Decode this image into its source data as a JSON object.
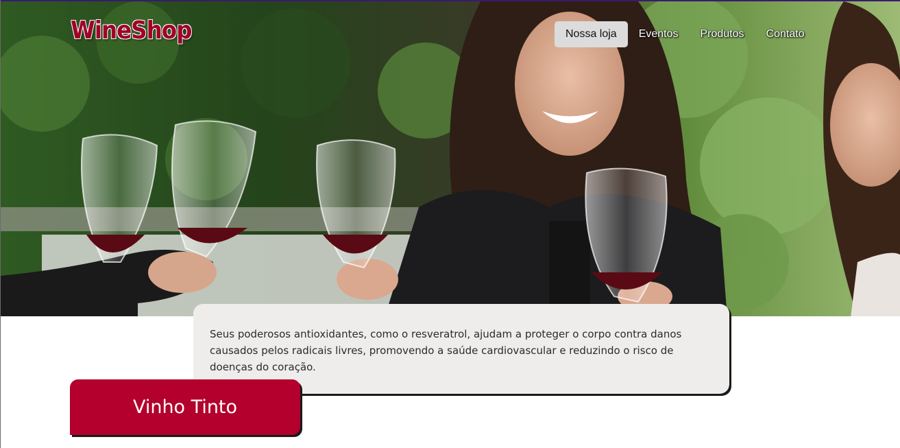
{
  "brand": {
    "name": "WineShop",
    "color": "#a00028"
  },
  "nav": {
    "items": [
      {
        "label": "Nossa loja",
        "active": true
      },
      {
        "label": "Eventos",
        "active": false
      },
      {
        "label": "Produtos",
        "active": false
      },
      {
        "label": "Contato",
        "active": false
      }
    ]
  },
  "hero": {
    "image": "photo-friends-toasting-red-wine-glasses"
  },
  "info_card": {
    "text": "Seus poderosos antioxidantes, como o resveratrol, ajudam a proteger o corpo contra danos causados pelos radicais livres, promovendo a saúde cardiovascular e reduzindo o risco de doenças do coração."
  },
  "product": {
    "label": "Vinho Tinto",
    "color": "#b3002c"
  }
}
